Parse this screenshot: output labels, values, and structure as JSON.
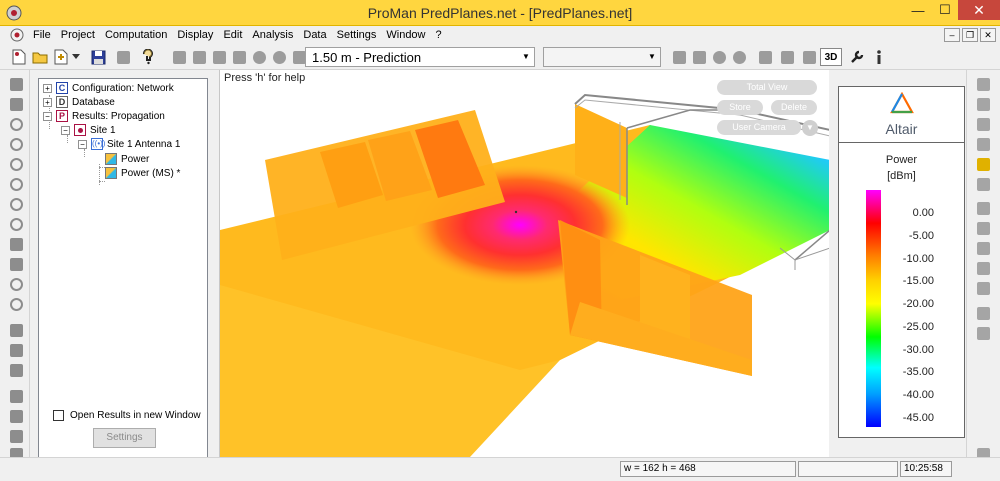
{
  "window": {
    "title": "ProMan PredPlanes.net - [PredPlanes.net]",
    "controls": {
      "minimize": "—",
      "maximize": "☐",
      "close": "✕"
    }
  },
  "menu": [
    "File",
    "Project",
    "Computation",
    "Display",
    "Edit",
    "Analysis",
    "Data",
    "Settings",
    "Window",
    "?"
  ],
  "mdi_controls": {
    "minimize": "–",
    "restore": "❐",
    "close": "✕"
  },
  "toolbar": {
    "prediction_combo": "1.50 m - Prediction",
    "second_combo": "",
    "view_3d": "3D"
  },
  "tree": {
    "items": [
      {
        "label": "Configuration: Network",
        "badge": "C"
      },
      {
        "label": "Database",
        "badge": "D"
      },
      {
        "label": "Results: Propagation",
        "badge": "P"
      },
      {
        "label": "Site  1"
      },
      {
        "label": "Site  1 Antenna 1"
      },
      {
        "label": "Power"
      },
      {
        "label": "Power (MS) *"
      }
    ],
    "open_in_new_window_label": "Open Results in new Window",
    "open_in_new_window_checked": false,
    "settings_button": "Settings"
  },
  "viewport": {
    "help_text": "Press 'h' for help",
    "overlay_buttons": {
      "total_view": "Total View",
      "store": "Store",
      "delete": "Delete",
      "user_camera": "User Camera"
    }
  },
  "legend": {
    "brand": "Altair",
    "title": "Power",
    "unit": "[dBm]",
    "labels": [
      "0.00",
      "-5.00",
      "-10.00",
      "-15.00",
      "-20.00",
      "-25.00",
      "-30.00",
      "-35.00",
      "-40.00",
      "-45.00"
    ],
    "colors": {
      "max": "#ff00ff",
      "high": "#ff0000",
      "mid_high": "#ff8000",
      "mid": "#ffff00",
      "mid_low": "#00ff00",
      "low": "#00ffff",
      "min": "#0000ff"
    }
  },
  "status": {
    "dimensions": "w = 162 h = 468",
    "time": "10:25:58"
  },
  "colors": {
    "titlebar": "#ffd63f",
    "close_button": "#c7473c"
  }
}
